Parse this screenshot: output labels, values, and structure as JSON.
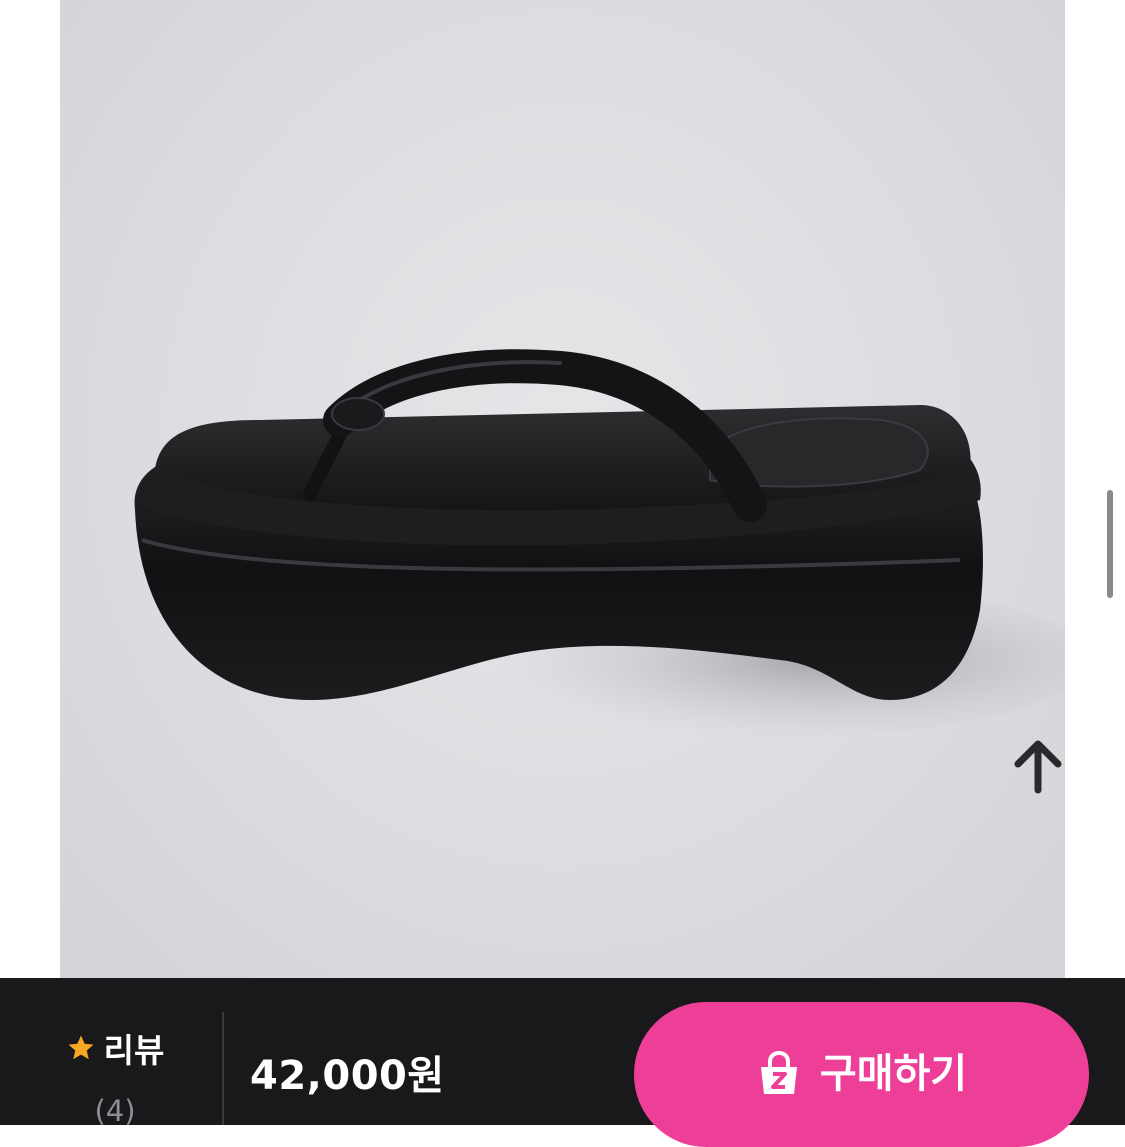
{
  "product": {
    "image_alt": "black platform thong sandal"
  },
  "controls": {
    "scroll_top_icon": "arrow-up-icon"
  },
  "bottom_bar": {
    "review_label": "리뷰",
    "review_count": "(4)",
    "review_icon": "star-icon",
    "price": "42,000원",
    "buy_label": "구매하기",
    "buy_icon": "shopping-bag-lock-icon"
  },
  "colors": {
    "accent": "#ee3f98",
    "bar_background": "#19191b",
    "star": "#f5a623",
    "photo_background": "#dcdce0"
  }
}
